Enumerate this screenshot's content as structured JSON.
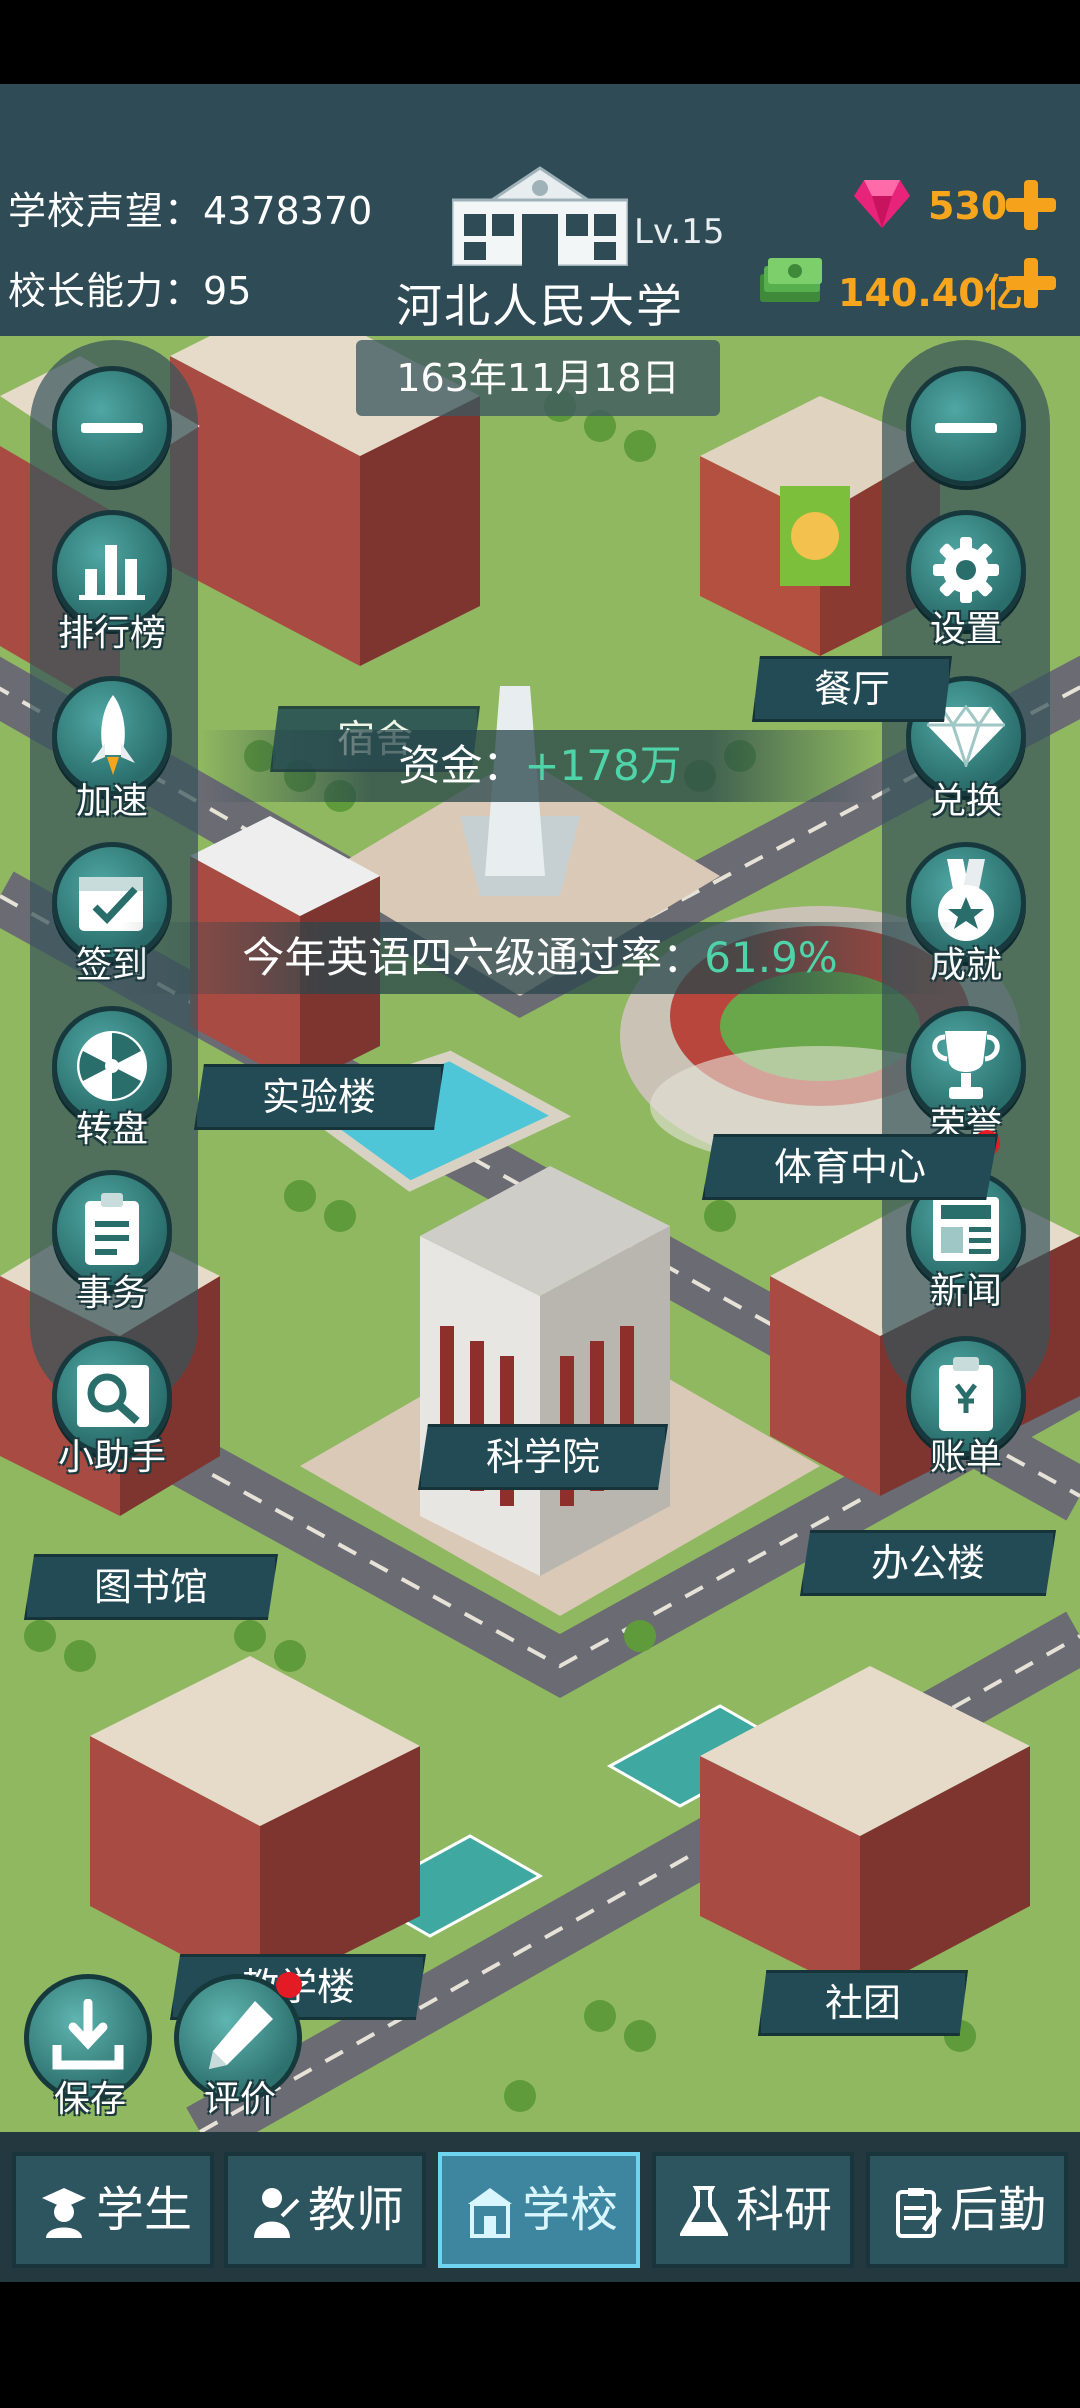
{
  "header": {
    "reputation_label": "学校声望：",
    "reputation_value": "4378370",
    "ability_label": "校长能力：",
    "ability_value": "95",
    "level": "Lv.15",
    "school_name": "河北人民大学",
    "date": "163年11月18日",
    "gems": "530",
    "money": "140.40亿"
  },
  "left_menu": [
    {
      "label": "排行榜"
    },
    {
      "label": "加速"
    },
    {
      "label": "签到"
    },
    {
      "label": "转盘"
    },
    {
      "label": "事务"
    },
    {
      "label": "小助手"
    }
  ],
  "right_menu": [
    {
      "label": "设置"
    },
    {
      "label": "兑换"
    },
    {
      "label": "成就"
    },
    {
      "label": "荣誉"
    },
    {
      "label": "新闻"
    },
    {
      "label": "账单"
    }
  ],
  "buildings": {
    "dorm": "宿舍",
    "canteen": "餐厅",
    "lab": "实验楼",
    "sports": "体育中心",
    "science": "科学院",
    "library": "图书馆",
    "office": "办公楼",
    "teaching": "教学楼",
    "club": "社团"
  },
  "info": {
    "funds_label": "资金：",
    "funds_value": "+178万",
    "pass_label": "今年英语四六级通过率：",
    "pass_value": "61.9%"
  },
  "bottom_actions": {
    "save": "保存",
    "rate": "评价"
  },
  "tabs": [
    {
      "label": "学生"
    },
    {
      "label": "教师"
    },
    {
      "label": "学校"
    },
    {
      "label": "科研"
    },
    {
      "label": "后勤"
    }
  ],
  "colors": {
    "header_bg": "#2f4b56",
    "resource_text": "#f7a51c",
    "highlight_value": "#4fd3a8",
    "active_tab": "#3e86a0"
  }
}
